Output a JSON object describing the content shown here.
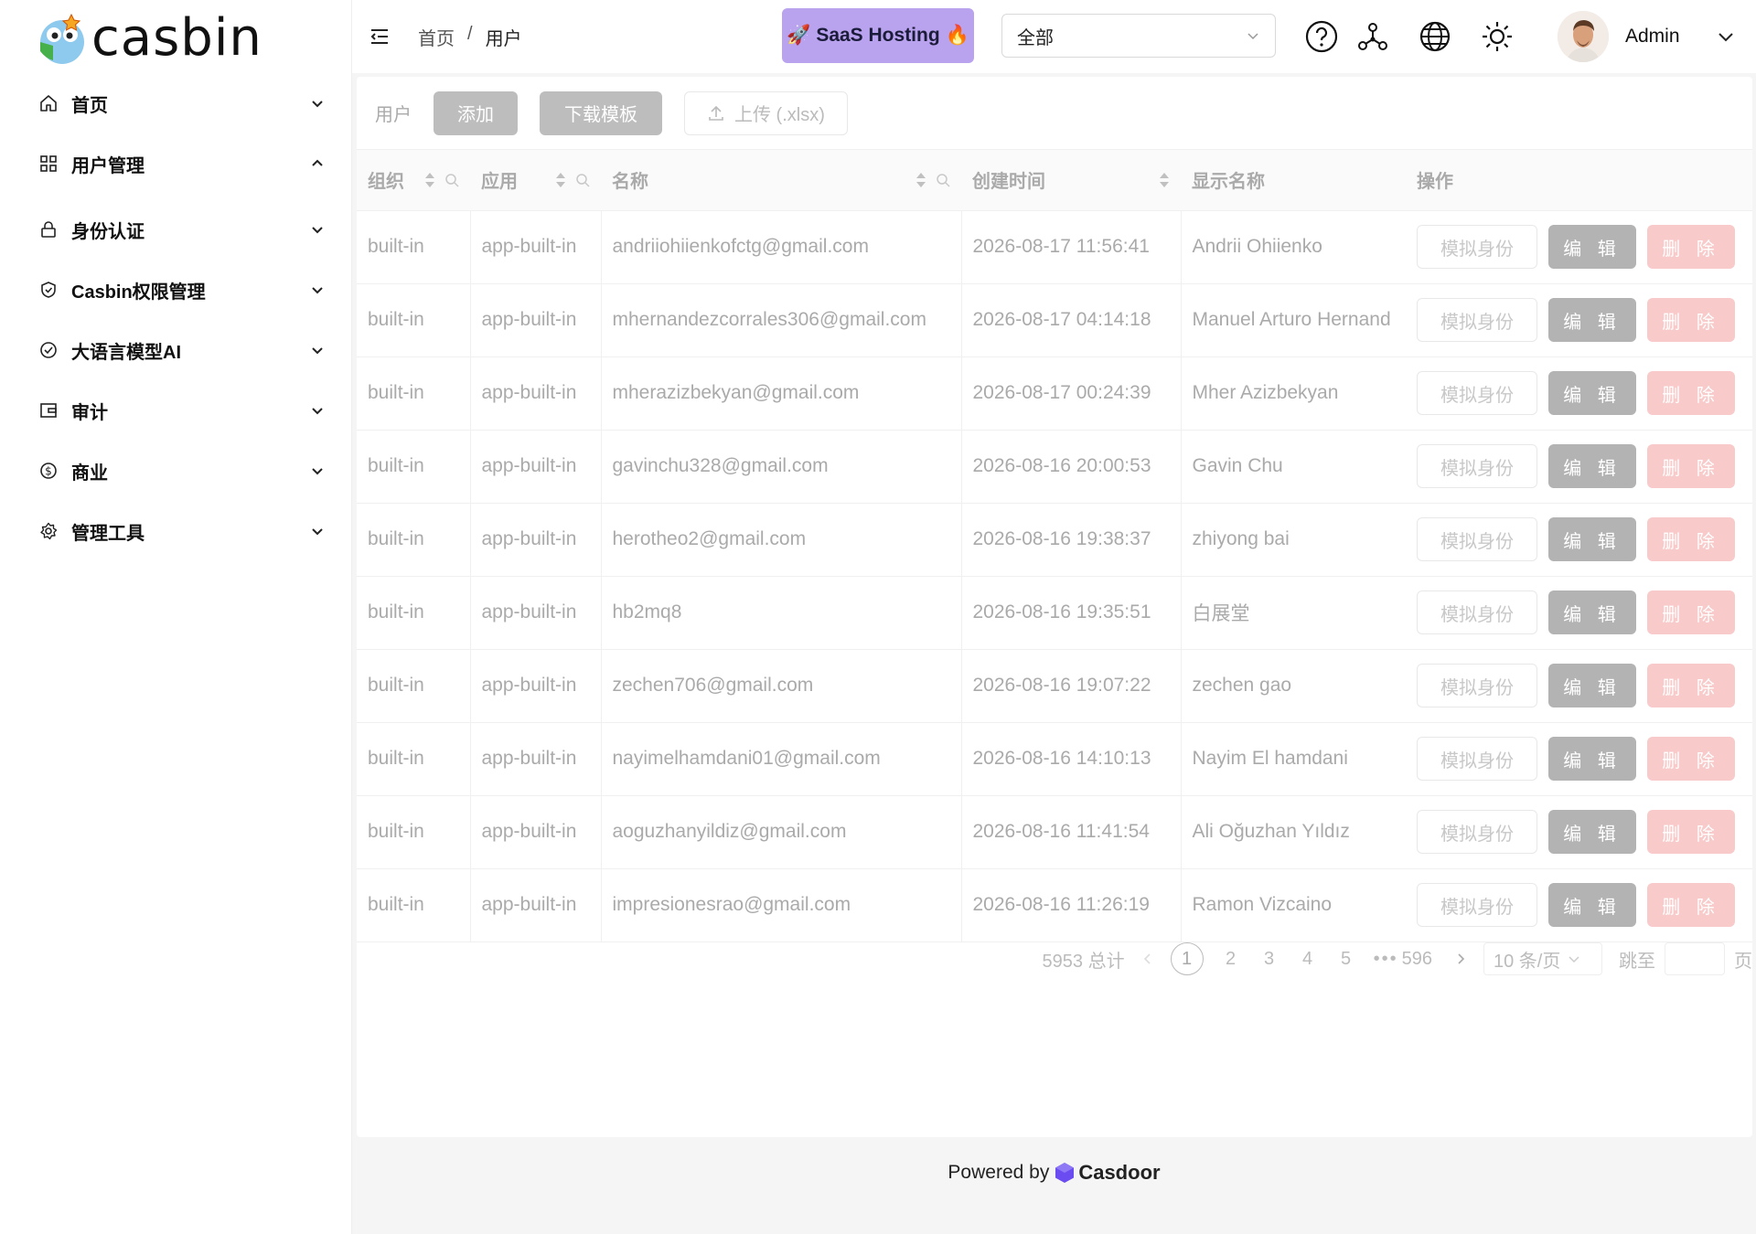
{
  "logo": {
    "text": "casbin",
    "icon": "casbin-logo-icon"
  },
  "sidebar": {
    "items": [
      {
        "label": "首页",
        "icon": "home-icon",
        "chevron": "down"
      },
      {
        "label": "用户管理",
        "icon": "grid-icon",
        "chevron": "up"
      },
      {
        "label": "身份认证",
        "icon": "lock-icon",
        "chevron": "down"
      },
      {
        "label": "Casbin权限管理",
        "icon": "shield-icon",
        "chevron": "down"
      },
      {
        "label": "大语言模型AI",
        "icon": "check-circle-icon",
        "chevron": "down"
      },
      {
        "label": "审计",
        "icon": "wallet-icon",
        "chevron": "down"
      },
      {
        "label": "商业",
        "icon": "dollar-icon",
        "chevron": "down"
      },
      {
        "label": "管理工具",
        "icon": "gear-icon",
        "chevron": "down"
      }
    ]
  },
  "topbar": {
    "breadcrumb": [
      "首页",
      "/",
      "用户"
    ],
    "saas_label": "SaaS Hosting",
    "org_select_value": "全部",
    "icons": [
      "help-icon",
      "network-icon",
      "globe-icon",
      "sun-icon"
    ],
    "username": "Admin"
  },
  "toolbar": {
    "title": "用户",
    "add_label": "添加",
    "download_label": "下载模板",
    "upload_label": "上传 (.xlsx)"
  },
  "table": {
    "columns": [
      "组织",
      "应用",
      "名称",
      "创建时间",
      "显示名称",
      "操作"
    ],
    "rows": [
      {
        "org": "built-in",
        "app": "app-built-in",
        "name": "andriiohiienkofctg@gmail.com",
        "created": "2026-08-17 11:56:41",
        "display": "Andrii Ohiienko"
      },
      {
        "org": "built-in",
        "app": "app-built-in",
        "name": "mhernandezcorrales306@gmail.com",
        "created": "2026-08-17 04:14:18",
        "display": "Manuel Arturo Hernand"
      },
      {
        "org": "built-in",
        "app": "app-built-in",
        "name": "mherazizbekyan@gmail.com",
        "created": "2026-08-17 00:24:39",
        "display": "Mher Azizbekyan"
      },
      {
        "org": "built-in",
        "app": "app-built-in",
        "name": "gavinchu328@gmail.com",
        "created": "2026-08-16 20:00:53",
        "display": "Gavin Chu"
      },
      {
        "org": "built-in",
        "app": "app-built-in",
        "name": "herotheo2@gmail.com",
        "created": "2026-08-16 19:38:37",
        "display": "zhiyong bai"
      },
      {
        "org": "built-in",
        "app": "app-built-in",
        "name": "hb2mq8",
        "created": "2026-08-16 19:35:51",
        "display": "白展堂"
      },
      {
        "org": "built-in",
        "app": "app-built-in",
        "name": "zechen706@gmail.com",
        "created": "2026-08-16 19:07:22",
        "display": "zechen gao"
      },
      {
        "org": "built-in",
        "app": "app-built-in",
        "name": "nayimelhamdani01@gmail.com",
        "created": "2026-08-16 14:10:13",
        "display": "Nayim El hamdani"
      },
      {
        "org": "built-in",
        "app": "app-built-in",
        "name": "aoguzhanyildiz@gmail.com",
        "created": "2026-08-16 11:41:54",
        "display": "Ali Oğuzhan Yıldız"
      },
      {
        "org": "built-in",
        "app": "app-built-in",
        "name": "impresionesrao@gmail.com",
        "created": "2026-08-16 11:26:19",
        "display": "Ramon Vizcaino"
      }
    ],
    "actions": {
      "impersonate": "模拟身份",
      "edit": "编 辑",
      "delete": "删 除"
    }
  },
  "pagination": {
    "total_text": "5953 总计",
    "current": "1",
    "pages": [
      "2",
      "3",
      "4",
      "5"
    ],
    "ellipsis": "•••",
    "last": "596",
    "page_size": "10 条/页",
    "jump_label": "跳至",
    "page_suffix": "页"
  },
  "footer": {
    "prefix": "Powered by",
    "brand": "Casdoor"
  },
  "colors": {
    "saas_bg": "#b9a2ee",
    "edit_bg": "#b3b3b3",
    "delete_bg": "#f8caca",
    "brand_purple": "#6a4cf0"
  }
}
